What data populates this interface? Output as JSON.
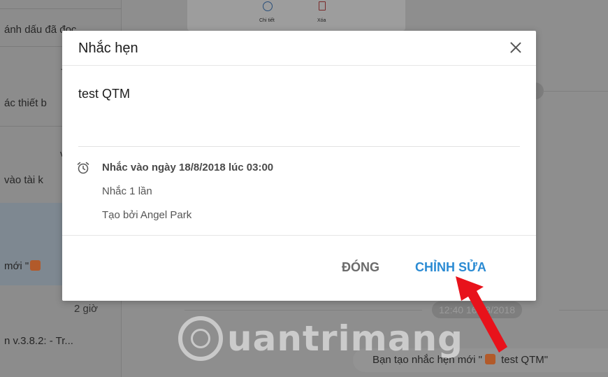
{
  "background": {
    "left_panel": {
      "items": [
        {
          "text": "ánh dấu đã đọc"
        },
        {
          "text": "ác thiết b"
        },
        {
          "text": "v"
        },
        {
          "text": "vào tài k"
        },
        {
          "text": "mới \""
        },
        {
          "text": "2 giờ"
        },
        {
          "text": "n v.3.8.2: - Tr..."
        }
      ]
    },
    "top_card": {
      "detail_label": "Chi tiết",
      "delete_label": "Xóa"
    },
    "pill_time_1": "8",
    "pill_time_2": "12:40 16/08/2018",
    "bottom_note": {
      "prefix": "Bạn tạo nhắc hẹn mới \"",
      "suffix": " test QTM\""
    }
  },
  "watermark": {
    "text": "uantrimang"
  },
  "modal": {
    "title": "Nhắc hẹn",
    "content": "test QTM",
    "reminder_time": "Nhắc vào ngày 18/8/2018 lúc 03:00",
    "repeat": "Nhắc 1 lần",
    "created_by": "Tạo bởi Angel Park",
    "buttons": {
      "close": "ĐÓNG",
      "edit": "CHỈNH SỬA"
    }
  },
  "colors": {
    "accent": "#2b8bd3",
    "arrow": "#e8121b",
    "overlay": "#8f8f8f"
  }
}
